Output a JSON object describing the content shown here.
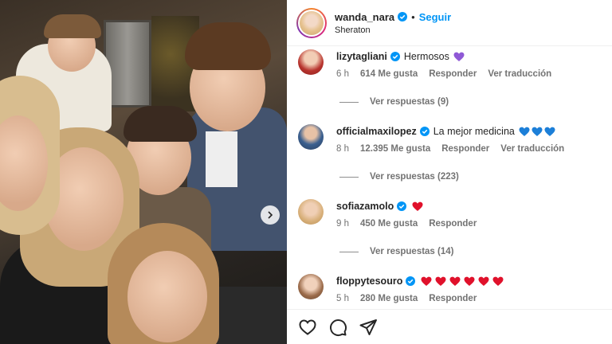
{
  "post": {
    "username": "wanda_nara",
    "follow_label": "Seguir",
    "separator": "•",
    "location": "Sheraton"
  },
  "comments": [
    {
      "username": "lizytagliani",
      "verified": true,
      "text": "Hermosos",
      "emoji": [
        "purple-heart"
      ],
      "time": "6 h",
      "likes": "614 Me gusta",
      "reply_label": "Responder",
      "translate_label": "Ver traducción",
      "view_replies": "Ver respuestas (9)"
    },
    {
      "username": "officialmaxilopez",
      "verified": true,
      "text": "La mejor medicina",
      "emoji": [
        "blue-heart",
        "blue-heart",
        "blue-heart"
      ],
      "time": "8 h",
      "likes": "12.395 Me gusta",
      "reply_label": "Responder",
      "translate_label": "Ver traducción",
      "view_replies": "Ver respuestas (223)"
    },
    {
      "username": "sofiazamolo",
      "verified": true,
      "text": "",
      "emoji": [
        "red-heart"
      ],
      "time": "9 h",
      "likes": "450 Me gusta",
      "reply_label": "Responder",
      "view_replies": "Ver respuestas (14)"
    },
    {
      "username": "floppytesouro",
      "verified": true,
      "text": "",
      "emoji": [
        "red-heart",
        "red-heart",
        "red-heart",
        "red-heart",
        "red-heart",
        "red-heart"
      ],
      "time": "5 h",
      "likes": "280 Me gusta",
      "reply_label": "Responder"
    }
  ],
  "colors": {
    "link_blue": "#0095f6",
    "verified_blue": "#0095f6",
    "meta_gray": "#737373",
    "red_heart": "#e0112b",
    "blue_heart": "#1c7fd8",
    "purple_heart": "#8f59d6"
  },
  "icons": {
    "like": "heart-outline-icon",
    "comment": "comment-bubble-icon",
    "share": "paper-plane-icon",
    "next": "chevron-right-icon"
  }
}
